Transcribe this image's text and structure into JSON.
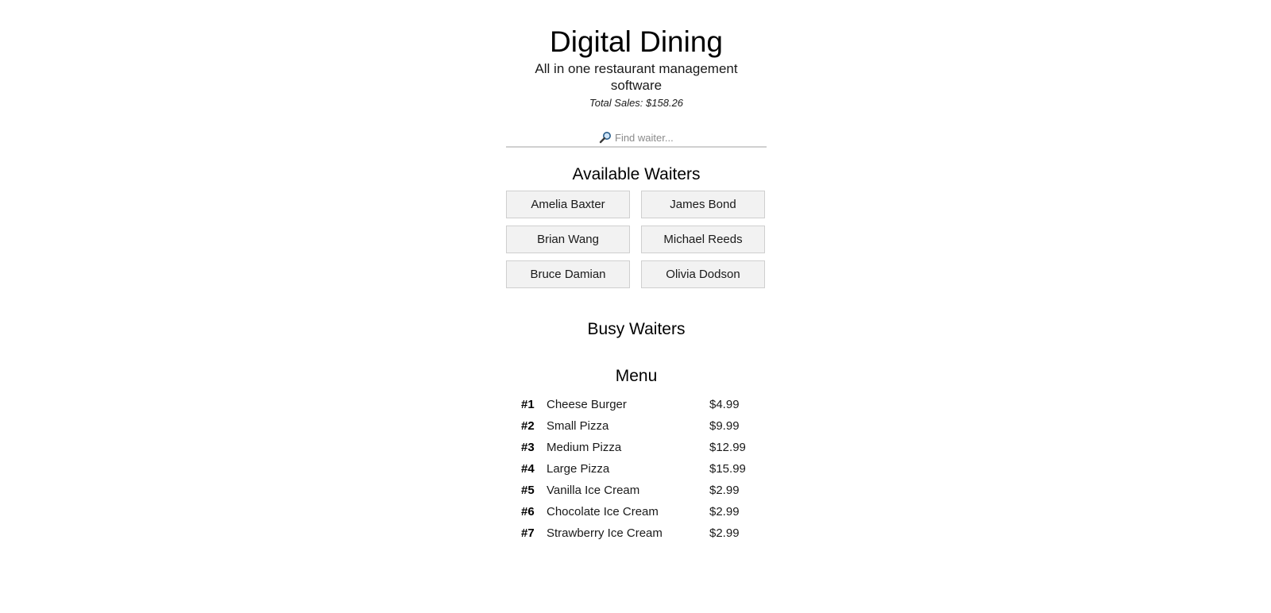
{
  "header": {
    "title": "Digital Dining",
    "tagline": "All in one restaurant management software",
    "total_sales": "Total Sales: $158.26"
  },
  "search": {
    "icon": "magnifier-icon",
    "placeholder": "Find waiter..."
  },
  "available_waiters": {
    "heading": "Available Waiters",
    "names": [
      "Amelia Baxter",
      "James Bond",
      "Brian Wang",
      "Michael Reeds",
      "Bruce Damian",
      "Olivia Dodson"
    ]
  },
  "busy_waiters": {
    "heading": "Busy Waiters",
    "names": []
  },
  "menu": {
    "heading": "Menu",
    "items": [
      {
        "num": "#1",
        "name": "Cheese Burger",
        "price": "$4.99"
      },
      {
        "num": "#2",
        "name": "Small Pizza",
        "price": "$9.99"
      },
      {
        "num": "#3",
        "name": "Medium Pizza",
        "price": "$12.99"
      },
      {
        "num": "#4",
        "name": "Large Pizza",
        "price": "$15.99"
      },
      {
        "num": "#5",
        "name": "Vanilla Ice Cream",
        "price": "$2.99"
      },
      {
        "num": "#6",
        "name": "Chocolate Ice Cream",
        "price": "$2.99"
      },
      {
        "num": "#7",
        "name": "Strawberry Ice Cream",
        "price": "$2.99"
      }
    ]
  }
}
